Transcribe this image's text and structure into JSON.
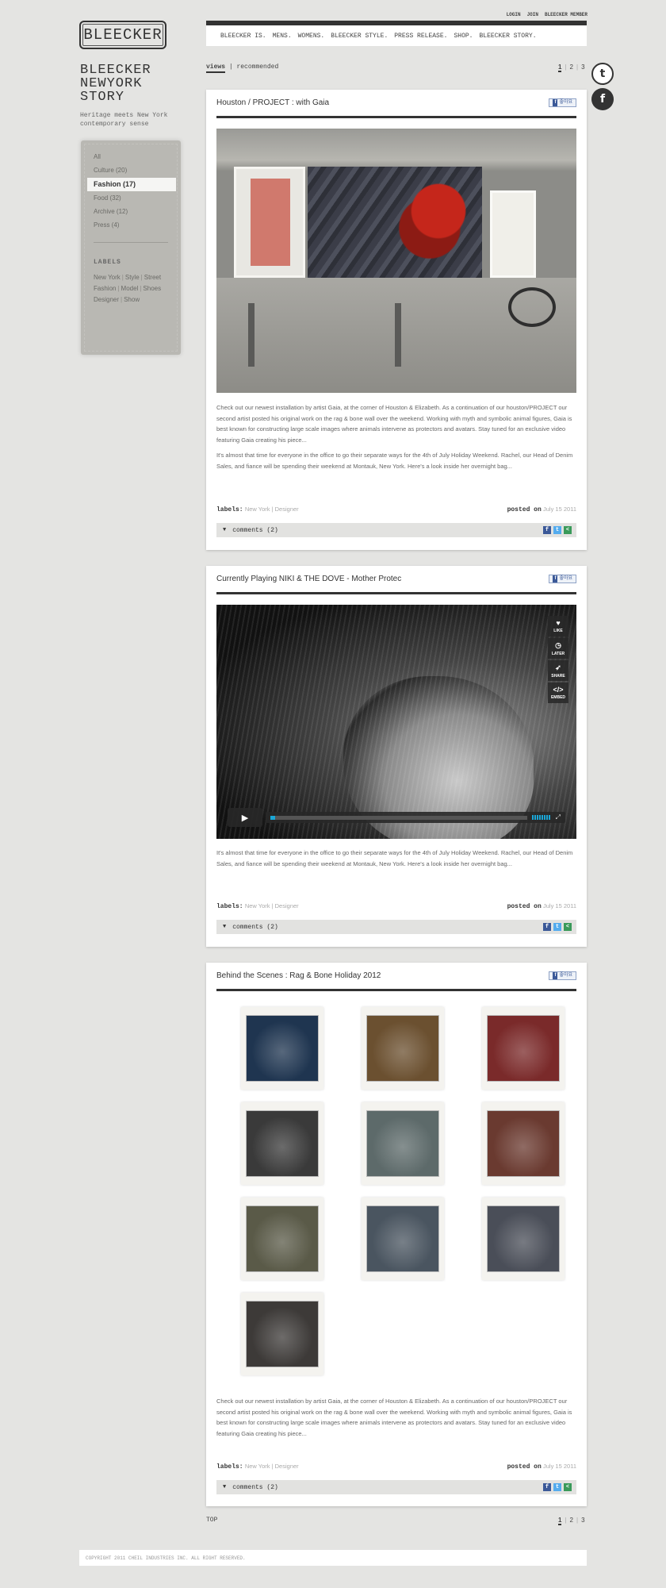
{
  "brand": {
    "logo": "BLEECKER",
    "title_lines": [
      "BLEECKER",
      "NEWYORK",
      "STORY"
    ],
    "tagline_lines": [
      "Heritage meets New York",
      "contemporary sense"
    ]
  },
  "toplinks": [
    "LOGIN",
    "JOIN",
    "BLEECKER MEMBER"
  ],
  "nav": [
    "BLEECKER IS.",
    "MENS.",
    "WOMENS.",
    "BLEECKER STYLE.",
    "PRESS RELEASE.",
    "SHOP.",
    "BLEECKER STORY."
  ],
  "view_tabs": {
    "views": "views",
    "sep": "|",
    "recommended": "recommended"
  },
  "pager": {
    "pages": [
      "1",
      "2",
      "3"
    ],
    "sep": "|"
  },
  "social": {
    "twitter": "t",
    "facebook": "f"
  },
  "sidebar": {
    "categories": [
      "All",
      "Culture (20)",
      "Fashion (17)",
      "Food (32)",
      "Archive (12)",
      "Press (4)"
    ],
    "labels_heading": "LABELS",
    "labels": [
      "New York",
      "Style",
      "Street",
      "Fashion",
      "Model",
      "Shoes",
      "Designer",
      "Show"
    ]
  },
  "like_label": "좋아요",
  "like_f": "f",
  "posts": [
    {
      "title": "Houston / PROJECT : with Gaia",
      "body": [
        "Check out our newest installation by artist Gaia, at the corner of Houston & Elizabeth. As a continuation of our houston/PROJECT our second artist posted his original work on the rag & bone wall over the weekend.",
        "Working with myth and symbolic animal figures, Gaia is best known for constructing large scale images where animals intervene as protectors and avatars. Stay tuned for an exclusive video featuring Gaia creating his piece...",
        "It's almost that time for everyone in the office to go their separate ways for the 4th of July Holiday Weekend.  Rachel, our Head of Denim Sales, and fiance will be spending their weekend at Montauk, New York.",
        "Here's a look inside her overnight bag..."
      ],
      "labels_key": "labels:",
      "labels_val": "New York | Designer",
      "posted_key": "posted on",
      "posted_val": "July 15 2011",
      "comments": "comments (2)"
    },
    {
      "title": "Currently Playing NIKI & THE DOVE - Mother Protec",
      "body": [
        "It's almost that time for everyone in the office to go their separate ways for the 4th of July Holiday Weekend.  Rachel, our Head of Denim Sales, and fiance will be spending their weekend at Montauk, New York.",
        "Here's a look inside her overnight bag..."
      ],
      "labels_key": "labels:",
      "labels_val": "New York | Designer",
      "posted_key": "posted on",
      "posted_val": "July 15 2011",
      "comments": "comments (2)",
      "video": {
        "like": "LIKE",
        "later": "LATER",
        "share": "SHARE",
        "embed": "EMBED",
        "progress": 0.02
      }
    },
    {
      "title": "Behind the Scenes : Rag & Bone Holiday 2012",
      "body": [
        "Check out our newest installation by artist Gaia, at the corner of Houston & Elizabeth. As a continuation of our houston/PROJECT our second artist posted his original work on the rag & bone wall over the weekend.",
        "Working with myth and symbolic animal figures, Gaia is best known for constructing large scale images where animals intervene as protectors and avatars. Stay tuned for an exclusive video featuring Gaia creating his piece..."
      ],
      "labels_key": "labels:",
      "labels_val": "New York | Designer",
      "posted_key": "posted on",
      "posted_val": "July 15 2011",
      "comments": "comments (2)",
      "thumb_colors": [
        "#1f3550",
        "#6b5030",
        "#7a2a2a",
        "#3a3a3a",
        "#5d6a6a",
        "#6a3a30",
        "#5a5a48",
        "#4a5560",
        "#4a4e58",
        "#3d3a38"
      ]
    }
  ],
  "footer": {
    "top": "TOP",
    "copyright": "COPYRIGHT 2011 CHEIL INDUSTRIES INC. ALL RIGHT RESERVED."
  }
}
